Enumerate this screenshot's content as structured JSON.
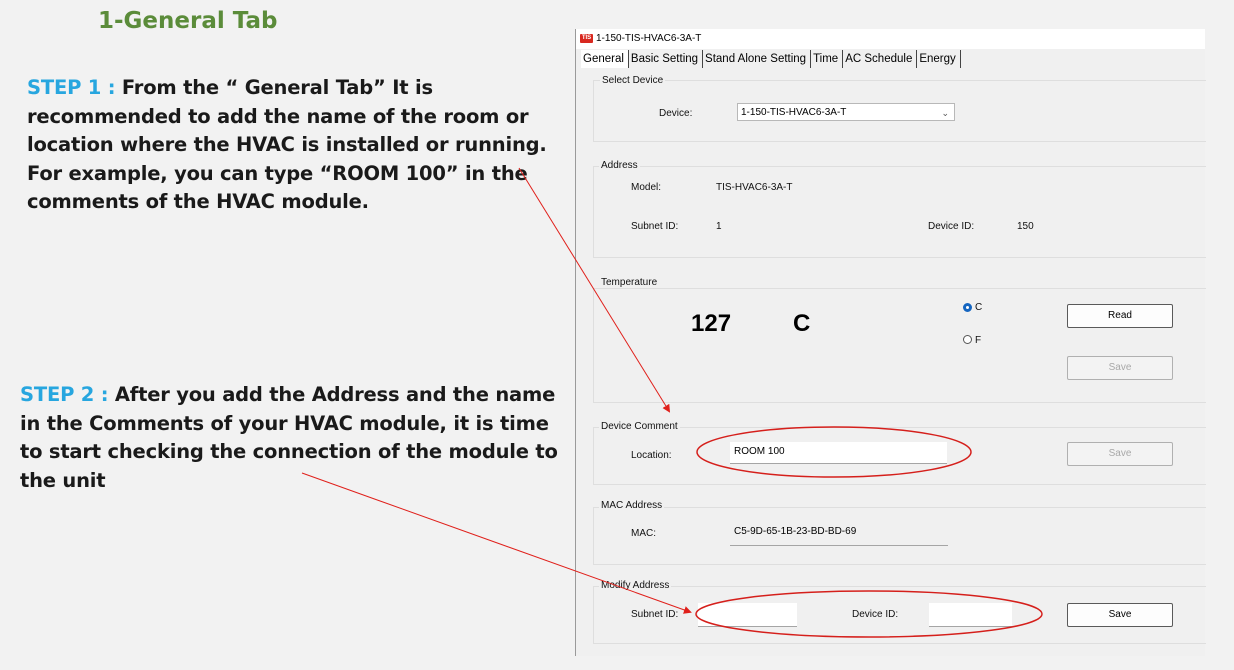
{
  "slide": {
    "title": "1-General Tab",
    "step1_lead": "STEP 1 :",
    "step1_text": " From the “ General Tab” It is recommended to add the name of the room or location where the HVAC is installed or running. For example, you can type “ROOM 100” in the comments of the HVAC module.",
    "step2_lead": "STEP 2 :",
    "step2_text": " After you add the Address and the name in the Comments of your HVAC module, it is time to start checking the connection of the module to the unit"
  },
  "window": {
    "icon_text": "TIS",
    "title": "1-150-TIS-HVAC6-3A-T",
    "tabs": [
      "General",
      "Basic Setting",
      "Stand Alone Setting",
      "Time",
      "AC Schedule",
      "Energy"
    ]
  },
  "select_device": {
    "group": "Select Device",
    "label": "Device:",
    "value": "1-150-TIS-HVAC6-3A-T"
  },
  "address": {
    "group": "Address",
    "model_label": "Model:",
    "model_value": "TIS-HVAC6-3A-T",
    "subnet_label": "Subnet ID:",
    "subnet_value": "1",
    "device_label": "Device ID:",
    "device_value": "150"
  },
  "temperature": {
    "group": "Temperature",
    "value": "127",
    "unit": "C",
    "radio_c": "C",
    "radio_f": "F",
    "selected": "C",
    "read_button": "Read",
    "save_button": "Save"
  },
  "device_comment": {
    "group": "Device Comment",
    "location_label": "Location:",
    "location_value": "ROOM 100",
    "save_button": "Save"
  },
  "mac_address": {
    "group": "MAC Address",
    "mac_label": "MAC:",
    "mac_value": "C5-9D-65-1B-23-BD-BD-69"
  },
  "modify_address": {
    "group": "Modify Address",
    "subnet_label": "Subnet ID:",
    "subnet_value": "",
    "device_label": "Device ID:",
    "device_value": "",
    "save_button": "Save"
  },
  "colors": {
    "title_green": "#5b8c3a",
    "step_blue": "#27a6df",
    "annotation_red": "#e0201b"
  }
}
